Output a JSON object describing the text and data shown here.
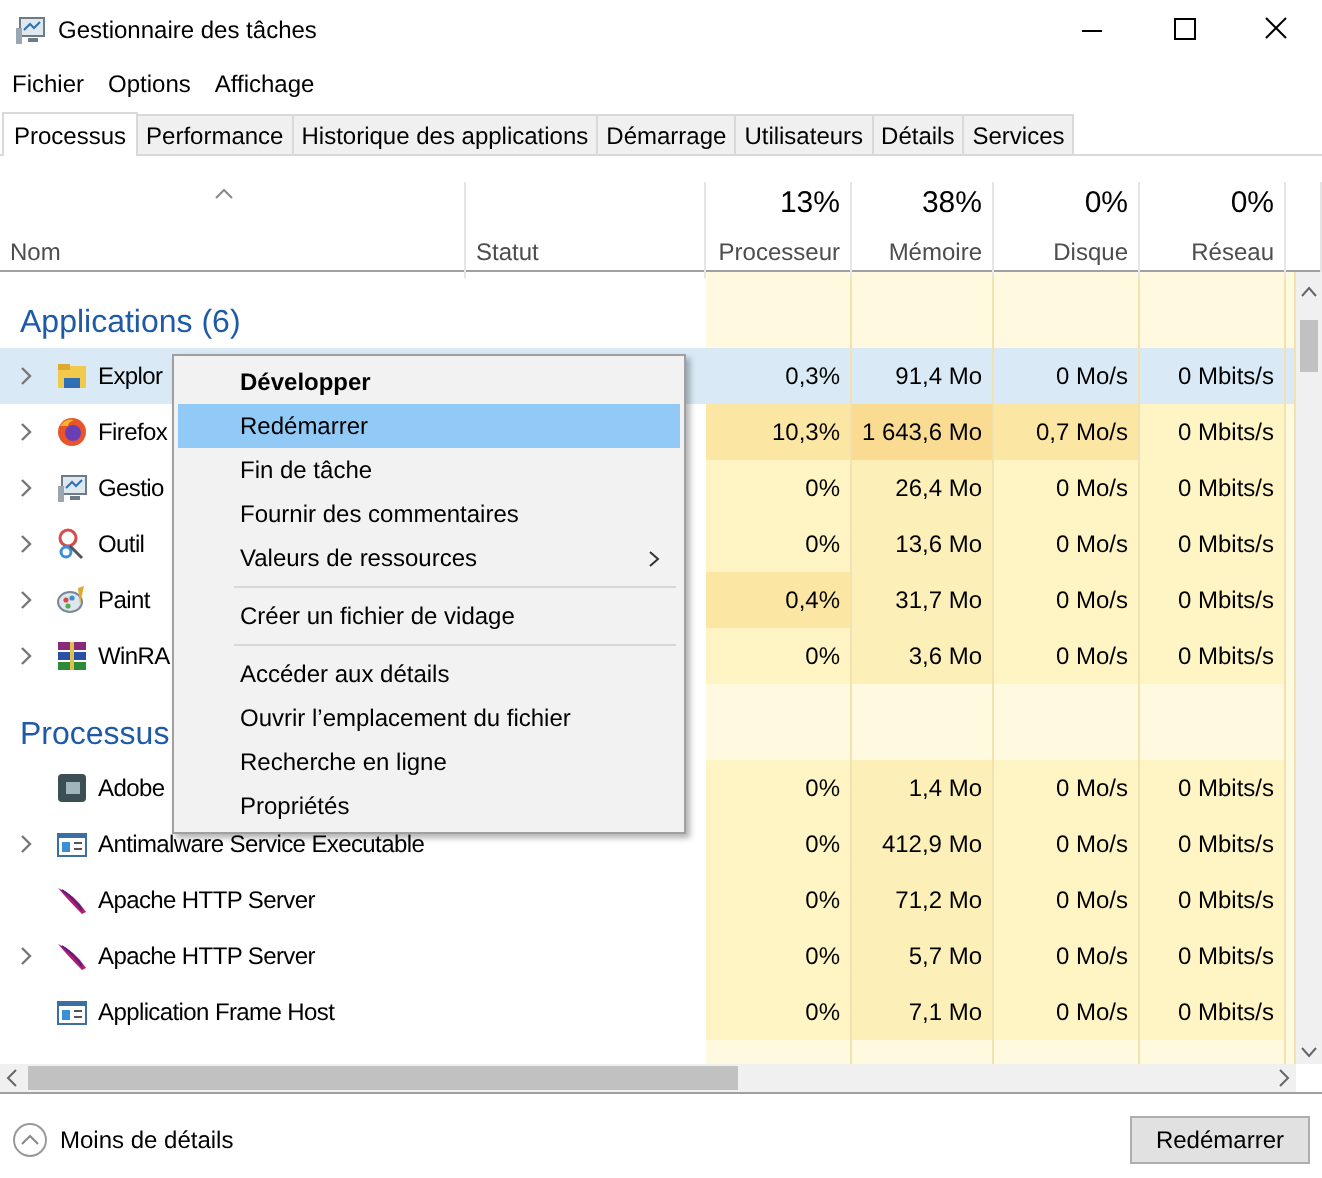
{
  "window": {
    "title": "Gestionnaire des tâches"
  },
  "menu": [
    "Fichier",
    "Options",
    "Affichage"
  ],
  "tabs": [
    {
      "label": "Processus",
      "selected": true
    },
    {
      "label": "Performance",
      "selected": false
    },
    {
      "label": "Historique des applications",
      "selected": false
    },
    {
      "label": "Démarrage",
      "selected": false
    },
    {
      "label": "Utilisateurs",
      "selected": false
    },
    {
      "label": "Détails",
      "selected": false
    },
    {
      "label": "Services",
      "selected": false
    }
  ],
  "columns": [
    {
      "label": "Nom",
      "sorted": true
    },
    {
      "label": "Statut",
      "sorted": false
    },
    {
      "label": "Processeur",
      "total": "13%",
      "sorted": false
    },
    {
      "label": "Mémoire",
      "total": "38%",
      "sorted": false
    },
    {
      "label": "Disque",
      "total": "0%",
      "sorted": false
    },
    {
      "label": "Réseau",
      "total": "0%",
      "sorted": false
    }
  ],
  "groups": [
    {
      "label": "Applications (6)",
      "rows": [
        {
          "name": "Explor",
          "kind": "folder",
          "expandable": true,
          "selected": true,
          "cells": [
            {
              "text": "0,3%"
            },
            {
              "text": "91,4 Mo"
            },
            {
              "text": "0 Mo/s"
            },
            {
              "text": "0 Mbits/s"
            }
          ]
        },
        {
          "name": "Firefox",
          "kind": "globe",
          "expandable": true,
          "selected": false,
          "cells": [
            {
              "text": "10,3%",
              "hot": true
            },
            {
              "text": "1 643,6 Mo",
              "hot": true
            },
            {
              "text": "0,7 Mo/s",
              "hot": true
            },
            {
              "text": "0 Mbits/s",
              "hot": false
            }
          ]
        },
        {
          "name": "Gestio",
          "kind": "monitor",
          "expandable": true,
          "selected": false,
          "cells": [
            {
              "text": "0%",
              "hot": false
            },
            {
              "text": "26,4 Mo",
              "hot": false
            },
            {
              "text": "0 Mo/s",
              "hot": false
            },
            {
              "text": "0 Mbits/s",
              "hot": false
            }
          ]
        },
        {
          "name": "Outil",
          "kind": "scissors",
          "expandable": true,
          "selected": false,
          "cells": [
            {
              "text": "0%",
              "hot": false
            },
            {
              "text": "13,6 Mo",
              "hot": false
            },
            {
              "text": "0 Mo/s",
              "hot": false
            },
            {
              "text": "0 Mbits/s",
              "hot": false
            }
          ]
        },
        {
          "name": "Paint",
          "kind": "palette",
          "expandable": true,
          "selected": false,
          "cells": [
            {
              "text": "0,4%",
              "hot": true
            },
            {
              "text": "31,7 Mo",
              "hot": false
            },
            {
              "text": "0 Mo/s",
              "hot": false
            },
            {
              "text": "0 Mbits/s",
              "hot": false
            }
          ]
        },
        {
          "name": "WinRA",
          "kind": "books",
          "expandable": true,
          "selected": false,
          "cells": [
            {
              "text": "0%",
              "hot": false
            },
            {
              "text": "3,6 Mo",
              "hot": false
            },
            {
              "text": "0 Mo/s",
              "hot": false
            },
            {
              "text": "0 Mbits/s",
              "hot": false
            }
          ]
        }
      ]
    },
    {
      "label": "Processus",
      "rows": [
        {
          "name": "Adobe",
          "kind": "tile",
          "expandable": false,
          "selected": false,
          "cells": [
            {
              "text": "0%",
              "hot": false
            },
            {
              "text": "1,4 Mo",
              "hot": false
            },
            {
              "text": "0 Mo/s",
              "hot": false
            },
            {
              "text": "0 Mbits/s",
              "hot": false
            }
          ]
        },
        {
          "name": "Antimalware Service Executable",
          "kind": "window",
          "expandable": true,
          "selected": false,
          "cells": [
            {
              "text": "0%",
              "hot": false
            },
            {
              "text": "412,9 Mo",
              "hot": false
            },
            {
              "text": "0 Mo/s",
              "hot": false
            },
            {
              "text": "0 Mbits/s",
              "hot": false
            }
          ]
        },
        {
          "name": "Apache HTTP Server",
          "kind": "feather",
          "expandable": false,
          "selected": false,
          "cells": [
            {
              "text": "0%",
              "hot": false
            },
            {
              "text": "71,2 Mo",
              "hot": false
            },
            {
              "text": "0 Mo/s",
              "hot": false
            },
            {
              "text": "0 Mbits/s",
              "hot": false
            }
          ]
        },
        {
          "name": "Apache HTTP Server",
          "kind": "feather",
          "expandable": true,
          "selected": false,
          "cells": [
            {
              "text": "0%",
              "hot": false
            },
            {
              "text": "5,7 Mo",
              "hot": false
            },
            {
              "text": "0 Mo/s",
              "hot": false
            },
            {
              "text": "0 Mbits/s",
              "hot": false
            }
          ]
        },
        {
          "name": "Application Frame Host",
          "kind": "window",
          "expandable": false,
          "selected": false,
          "cells": [
            {
              "text": "0%",
              "hot": false
            },
            {
              "text": "7,1 Mo",
              "hot": false
            },
            {
              "text": "0 Mo/s",
              "hot": false
            },
            {
              "text": "0 Mbits/s",
              "hot": false
            }
          ]
        }
      ]
    }
  ],
  "context_menu": [
    {
      "label": "Développer",
      "kind": "default",
      "selected": false
    },
    {
      "label": "Redémarrer",
      "kind": "item",
      "selected": true
    },
    {
      "label": "Fin de tâche",
      "kind": "item",
      "selected": false
    },
    {
      "label": "Fournir des commentaires",
      "kind": "item",
      "selected": false
    },
    {
      "label": "Valeurs de ressources",
      "kind": "submenu",
      "selected": false
    },
    {
      "kind": "separator"
    },
    {
      "label": "Créer un fichier de vidage",
      "kind": "item",
      "selected": false
    },
    {
      "kind": "separator"
    },
    {
      "label": "Accéder aux détails",
      "kind": "item",
      "selected": false
    },
    {
      "label": "Ouvrir l’emplacement du fichier",
      "kind": "item",
      "selected": false
    },
    {
      "label": "Recherche en ligne",
      "kind": "item",
      "selected": false
    },
    {
      "label": "Propriétés",
      "kind": "item",
      "selected": false
    }
  ],
  "footer": {
    "details_toggle": "Moins de détails",
    "action_button": "Redémarrer"
  }
}
